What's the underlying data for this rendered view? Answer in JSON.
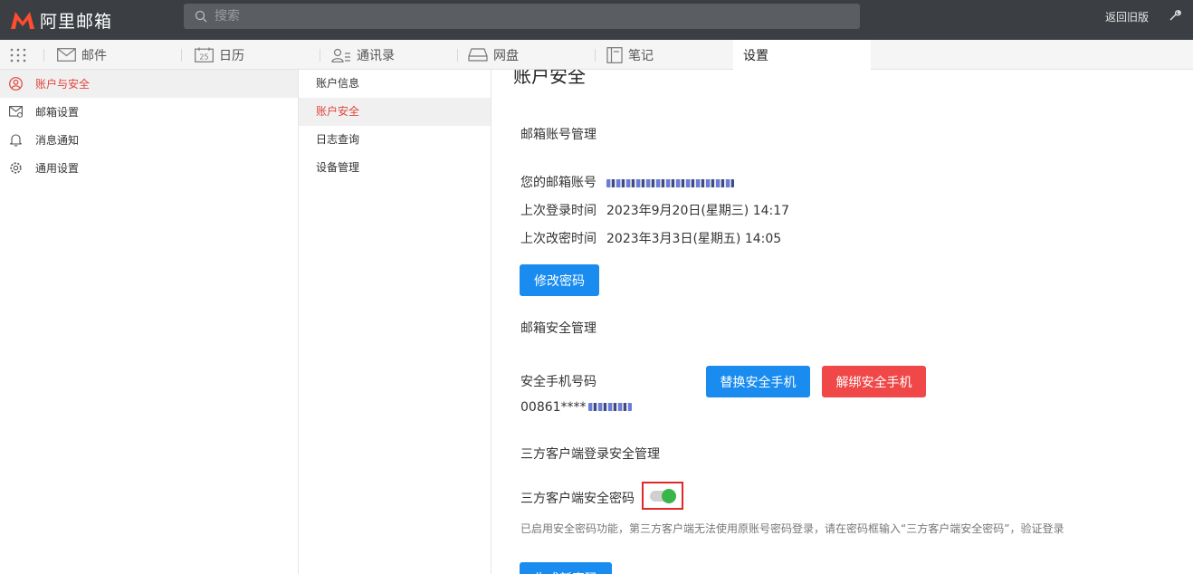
{
  "app": {
    "brand": "阿里邮箱",
    "brand_color": "#ff4d2e",
    "search_placeholder": "搜索",
    "back_old": "返回旧版"
  },
  "tabs": [
    {
      "label": "邮件",
      "icon": "mail-icon"
    },
    {
      "label": "日历",
      "icon": "calendar-icon",
      "icon_text": "25"
    },
    {
      "label": "通讯录",
      "icon": "contacts-icon"
    },
    {
      "label": "网盘",
      "icon": "drive-icon"
    },
    {
      "label": "笔记",
      "icon": "note-icon"
    },
    {
      "label": "设置",
      "active": true
    }
  ],
  "leftnav": [
    {
      "label": "账户与安全",
      "icon": "user-circle-icon",
      "active": true
    },
    {
      "label": "邮箱设置",
      "icon": "mail-settings-icon"
    },
    {
      "label": "消息通知",
      "icon": "bell-icon"
    },
    {
      "label": "通用设置",
      "icon": "gear-icon"
    }
  ],
  "subnav": [
    {
      "label": "账户信息"
    },
    {
      "label": "账户安全",
      "active": true
    },
    {
      "label": "日志查询"
    },
    {
      "label": "设备管理"
    }
  ],
  "main": {
    "title": "账户安全",
    "account_section": "邮箱账号管理",
    "account_label": "您的邮箱账号",
    "last_login_label": "上次登录时间",
    "last_login_value": "2023年9月20日(星期三) 14:17",
    "last_pwd_label": "上次改密时间",
    "last_pwd_value": "2023年3月3日(星期五) 14:05",
    "change_pwd_btn": "修改密码",
    "security_section": "邮箱安全管理",
    "phone_label": "安全手机号码",
    "phone_value": "00861****",
    "replace_phone_btn": "替换安全手机",
    "unbind_phone_btn": "解绑安全手机",
    "third_party_section": "三方客户端登录安全管理",
    "third_party_label": "三方客户端安全密码",
    "third_party_enabled": true,
    "hint": "已启用安全密码功能，第三方客户端无法使用原账号密码登录，请在密码框输入“三方客户端安全密码”，验证登录",
    "generate_btn": "生成新密码"
  },
  "colors": {
    "accent_red": "#e0453e",
    "primary_blue": "#1a8cf0",
    "danger_red": "#f04848",
    "toggle_green": "#3ab54a"
  }
}
